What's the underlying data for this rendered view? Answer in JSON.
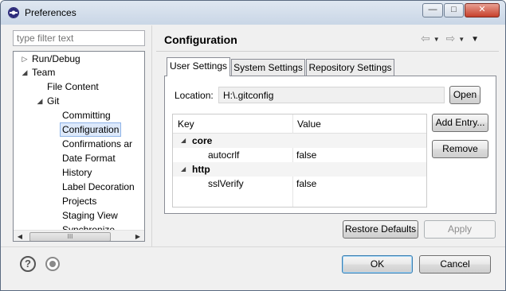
{
  "window": {
    "title": "Preferences",
    "controls": {
      "minimize": "—",
      "maximize": "□",
      "close": "✕"
    }
  },
  "filter": {
    "placeholder": "type filter text"
  },
  "tree": {
    "items": [
      {
        "label": "Run/Debug",
        "twisty": "▷"
      },
      {
        "label": "Team",
        "twisty": "◢"
      },
      {
        "label": "File Content",
        "twisty": ""
      },
      {
        "label": "Git",
        "twisty": "◢"
      },
      {
        "label": "Committing",
        "twisty": ""
      },
      {
        "label": "Configuration",
        "twisty": "",
        "selected": true
      },
      {
        "label": "Confirmations ar",
        "twisty": ""
      },
      {
        "label": "Date Format",
        "twisty": ""
      },
      {
        "label": "History",
        "twisty": ""
      },
      {
        "label": "Label Decoration",
        "twisty": ""
      },
      {
        "label": "Projects",
        "twisty": ""
      },
      {
        "label": "Staging View",
        "twisty": ""
      },
      {
        "label": "Synchronize",
        "twisty": ""
      }
    ],
    "scroll": {
      "up": "▲",
      "down": "▼",
      "left": "◀",
      "right": "▶",
      "grip_v": "≡",
      "grip_h": "III"
    }
  },
  "page": {
    "title": "Configuration",
    "nav": {
      "back": "⇦",
      "forward": "⇨",
      "dropdown": "▼",
      "menu": "▼"
    }
  },
  "tabs": [
    {
      "label": "User Settings",
      "active": true
    },
    {
      "label": "System Settings",
      "active": false
    },
    {
      "label": "Repository Settings",
      "active": false
    }
  ],
  "location": {
    "label": "Location:",
    "value": "H:\\.gitconfig",
    "open_button": "Open"
  },
  "table": {
    "columns": [
      "Key",
      "Value"
    ],
    "rows": [
      {
        "key": "core",
        "value": "",
        "group": true,
        "twisty": "◢"
      },
      {
        "key": "autocrlf",
        "value": "false",
        "group": false
      },
      {
        "key": "http",
        "value": "",
        "group": true,
        "twisty": "◢"
      },
      {
        "key": "sslVerify",
        "value": "false",
        "group": false
      }
    ]
  },
  "side_buttons": {
    "add_entry": "Add Entry...",
    "remove": "Remove"
  },
  "footer": {
    "restore_defaults": "Restore Defaults",
    "apply": "Apply",
    "ok": "OK",
    "cancel": "Cancel",
    "help_icon": "?"
  }
}
